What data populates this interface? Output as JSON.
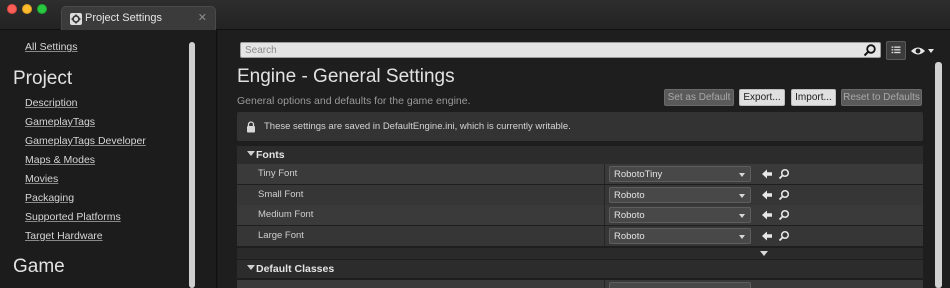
{
  "window": {
    "tab_title": "Project Settings",
    "tab_close": "✕"
  },
  "sidebar": {
    "all_settings": "All Settings",
    "section_project": "Project",
    "items": [
      {
        "label": "Description"
      },
      {
        "label": "GameplayTags"
      },
      {
        "label": "GameplayTags Developer"
      },
      {
        "label": "Maps & Modes"
      },
      {
        "label": "Movies"
      },
      {
        "label": "Packaging"
      },
      {
        "label": "Supported Platforms"
      },
      {
        "label": "Target Hardware"
      }
    ],
    "section_game": "Game"
  },
  "search": {
    "placeholder": "Search",
    "value": ""
  },
  "header": {
    "title": "Engine - General Settings",
    "subtitle": "General options and defaults for the game engine."
  },
  "actions": {
    "set_as_default": "Set as Default",
    "export": "Export...",
    "import": "Import...",
    "reset_to_defaults": "Reset to Defaults"
  },
  "notice": {
    "text": "These settings are saved in DefaultEngine.ini, which is currently writable."
  },
  "categories": {
    "fonts": {
      "label": "Fonts",
      "rows": [
        {
          "label": "Tiny Font",
          "value": "RobotoTiny"
        },
        {
          "label": "Small Font",
          "value": "Roboto"
        },
        {
          "label": "Medium Font",
          "value": "Roboto"
        },
        {
          "label": "Large Font",
          "value": "Roboto"
        }
      ]
    },
    "default_classes": {
      "label": "Default Classes"
    }
  },
  "icons": {
    "tab": "gear-icon",
    "search": "search-icon",
    "view_options": "list-view-icon",
    "visibility": "eye-icon",
    "lock": "lock-icon",
    "reset": "reset-arrow-icon",
    "browse": "browse-search-icon"
  },
  "colors": {
    "mac_close": "#fc5f57",
    "mac_minimize": "#fdbc2e",
    "mac_zoom": "#28c840",
    "panel_bg": "#1e1e1e",
    "row_bg": "#3a3a3a"
  }
}
